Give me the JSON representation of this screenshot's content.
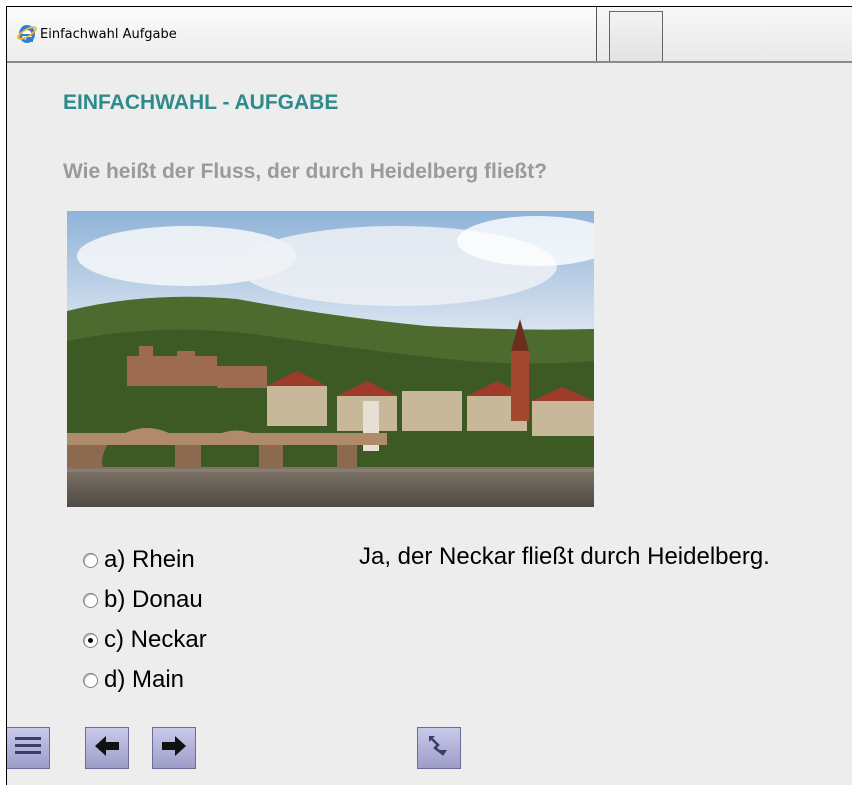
{
  "window": {
    "tab_title": "Einfachwahl Aufgabe",
    "icon": "ie-icon"
  },
  "task": {
    "heading": "EINFACHWAHL - AUFGABE",
    "question": "Wie heißt der Fluss, der durch Heidelberg fließt?",
    "image_subject": "heidelberg-old-bridge-photo"
  },
  "options": [
    {
      "label": "a) Rhein",
      "selected": false
    },
    {
      "label": "b) Donau",
      "selected": false
    },
    {
      "label": "c) Neckar",
      "selected": true
    },
    {
      "label": "d) Main",
      "selected": false
    }
  ],
  "feedback": "Ja, der Neckar fließt durch Heidelberg.",
  "toolbar": {
    "buttons": [
      "menu-icon",
      "arrow-left-icon",
      "arrow-right-icon",
      "redo-icon"
    ]
  },
  "colors": {
    "heading": "#2f8a8c",
    "question": "#9a9a9a",
    "background": "#ededed",
    "button": "#b4b4dc"
  }
}
